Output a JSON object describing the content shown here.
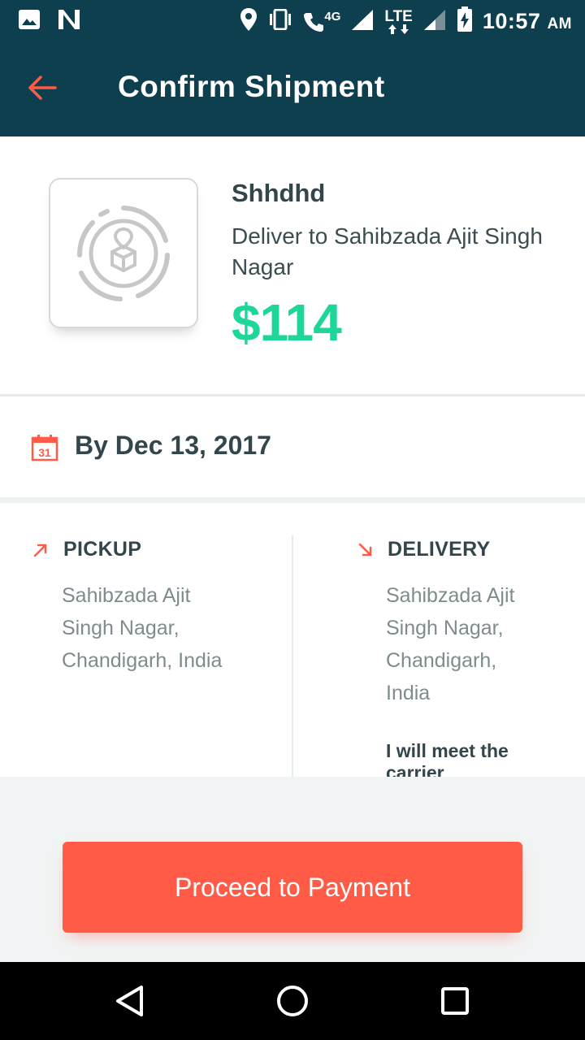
{
  "status_bar": {
    "time": "10:57",
    "am_pm": "AM",
    "network_4g": "4G",
    "network_lte": "LTE",
    "icons": [
      "image-icon",
      "n-notification-icon",
      "location-icon",
      "vibrate-icon",
      "wifi-call-icon",
      "signal-icon",
      "signal-icon",
      "battery-charging-icon"
    ]
  },
  "app_bar": {
    "title": "Confirm Shipment"
  },
  "item": {
    "name": "Shhdhd",
    "destination": "Deliver to Sahibzada Ajit Singh Nagar",
    "price": "$114"
  },
  "date": {
    "label": "By Dec 13, 2017",
    "calendar_day": "31"
  },
  "pickup": {
    "heading": "PICKUP",
    "lines": [
      "Sahibzada Ajit",
      "Singh Nagar,",
      "Chandigarh, India"
    ]
  },
  "delivery": {
    "heading": "DELIVERY",
    "lines": [
      "Sahibzada Ajit",
      "Singh Nagar,",
      "Chandigarh,",
      "India"
    ],
    "note_lines": [
      "I will meet the",
      "carrier"
    ]
  },
  "actions": {
    "proceed_label": "Proceed to Payment"
  },
  "colors": {
    "header": "#0e3f4e",
    "accent": "#ff5b47",
    "price": "#1ed69a"
  }
}
